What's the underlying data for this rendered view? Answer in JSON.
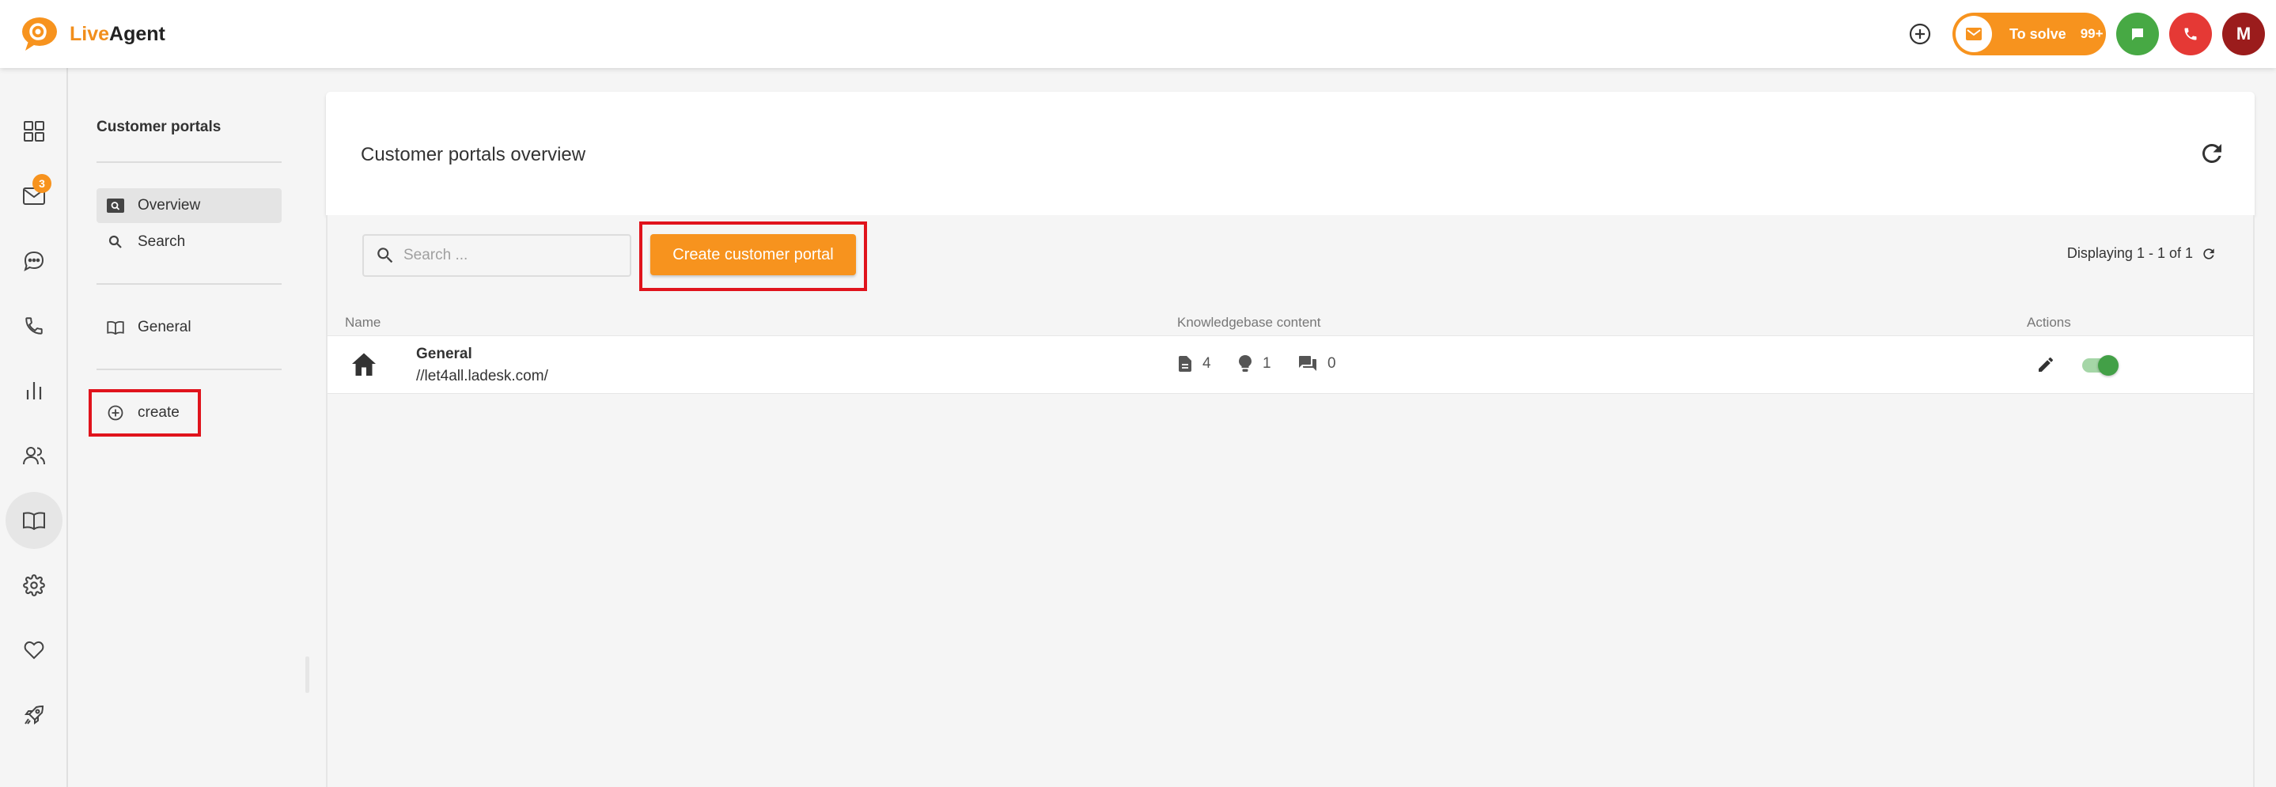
{
  "app": {
    "logo_live": "Live",
    "logo_agent": "Agent"
  },
  "header": {
    "to_solve_label": "To solve",
    "to_solve_count": "99+",
    "avatar_initial": "M",
    "colors": {
      "accent": "#f7931e",
      "chat": "#47a944",
      "phone": "#e53935",
      "avatar": "#9b1c1c"
    }
  },
  "leftnav": {
    "items": [
      {
        "icon": "dashboard-icon"
      },
      {
        "icon": "mail-icon",
        "badge": "3"
      },
      {
        "icon": "chat-icon"
      },
      {
        "icon": "phone-icon"
      },
      {
        "icon": "reports-icon"
      },
      {
        "icon": "contacts-icon"
      },
      {
        "icon": "knowledgebase-icon",
        "active": true
      },
      {
        "icon": "settings-icon"
      },
      {
        "icon": "heart-icon"
      },
      {
        "icon": "rocket-icon"
      }
    ]
  },
  "subpanel": {
    "title": "Customer portals",
    "items": [
      {
        "label": "Overview",
        "icon": "overview-icon",
        "active": true
      },
      {
        "label": "Search",
        "icon": "search-icon"
      },
      {
        "label": "General",
        "icon": "book-icon"
      },
      {
        "label": "create",
        "icon": "add-circle-icon"
      }
    ]
  },
  "main": {
    "title": "Customer portals overview",
    "search_placeholder": "Search ...",
    "create_button": "Create customer portal",
    "displaying": "Displaying 1 - 1 of 1",
    "columns": {
      "name": "Name",
      "kb": "Knowledgebase content",
      "actions": "Actions"
    },
    "rows": [
      {
        "name": "General",
        "url": "//let4all.ladesk.com/",
        "articles": "4",
        "ideas": "1",
        "forum": "0",
        "enabled": true
      }
    ]
  }
}
